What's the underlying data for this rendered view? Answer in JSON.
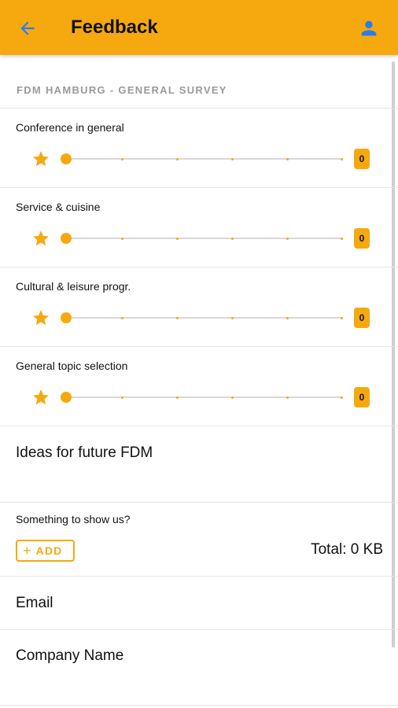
{
  "appbar": {
    "title": "Feedback",
    "back_icon": "arrow-back-icon",
    "user_icon": "person-icon"
  },
  "colors": {
    "accent": "#F6A90F",
    "text": "#111111",
    "muted": "#9A9A9A"
  },
  "survey": {
    "header": "FDM HAMBURG - GENERAL SURVEY",
    "questions": [
      {
        "label": "Conference in general",
        "value": "0"
      },
      {
        "label": "Service & cuisine",
        "value": "0"
      },
      {
        "label": "Cultural & leisure progr.",
        "value": "0"
      },
      {
        "label": "General topic selection",
        "value": "0"
      }
    ]
  },
  "ideas": {
    "placeholder": "Ideas for future FDM"
  },
  "attachments": {
    "label": "Something to show us?",
    "add_label": "ADD",
    "total": "Total: 0 KB"
  },
  "email": {
    "placeholder": "Email"
  },
  "company": {
    "placeholder": "Company Name"
  }
}
